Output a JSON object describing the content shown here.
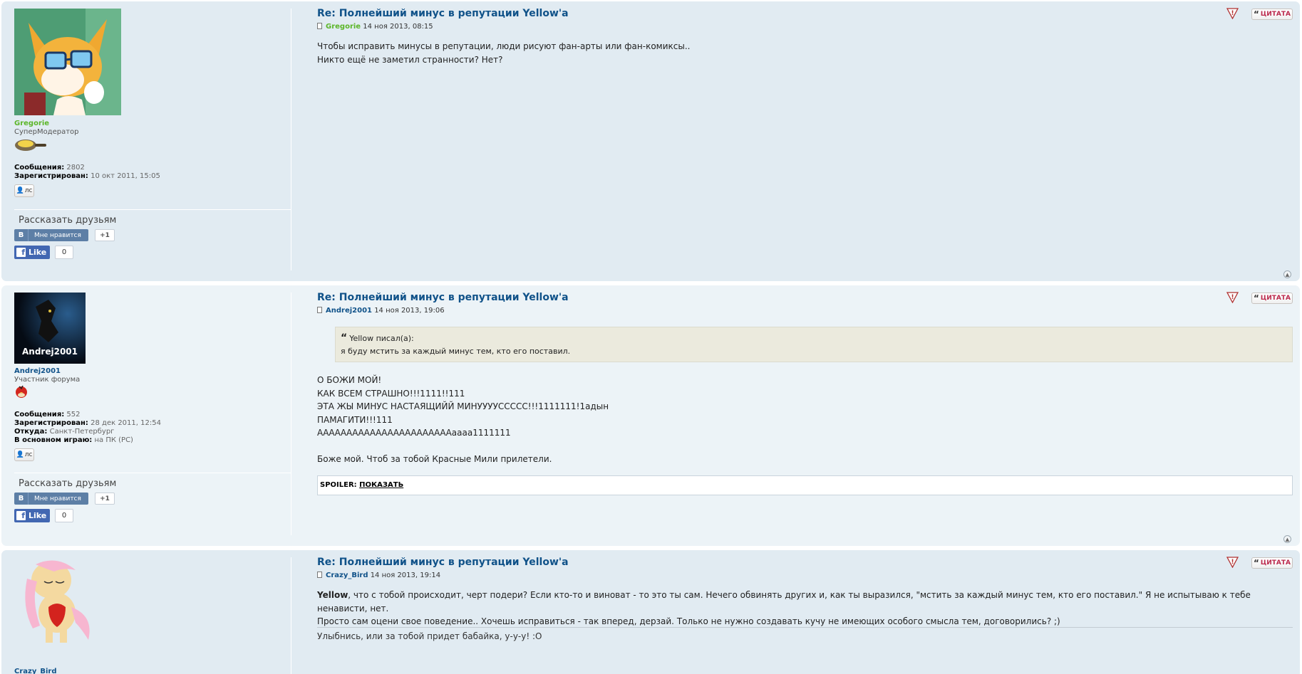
{
  "colors": {
    "post_bg_1": "#e1ebf2",
    "post_bg_2": "#ecf3f7",
    "link": "#105289",
    "moderator": "#5cb629",
    "quote_red": "#bc2a4d"
  },
  "common": {
    "pm_label": "лс",
    "tell_friends": "Рассказать друзьям",
    "vk_letter": "В",
    "vk_like": "Мне нравится",
    "vk_count": "+1",
    "fb_like": "Like",
    "fb_count": "0",
    "quote_label": "ЦИТАТА",
    "report_icon": "warning-icon",
    "top_icon": "arrow-up-icon"
  },
  "posts": [
    {
      "username": "Gregorie",
      "rank": "СуперМодератор",
      "stats": [
        {
          "k": "Сообщения:",
          "v": "2802"
        },
        {
          "k": "Зарегистрирован:",
          "v": "10 окт 2011, 15:05"
        }
      ],
      "title": "Re: Полнейший минус в репутации Yellow'a",
      "author": "Gregorie",
      "date": "14 ноя 2013, 08:15",
      "lines": [
        "Чтобы исправить минусы в репутации, люди рисуют фан-арты или фан-комиксы..",
        "Никто ещё не заметил странности? Нет?"
      ]
    },
    {
      "username": "Andrej2001",
      "avatar_text": "Andrej2001",
      "rank": "Участник форума",
      "stats": [
        {
          "k": "Сообщения:",
          "v": "552"
        },
        {
          "k": "Зарегистрирован:",
          "v": "28 дек 2011, 12:54"
        },
        {
          "k": "Откуда:",
          "v": "Санкт-Петербург"
        },
        {
          "k": "В основном играю:",
          "v": "на ПК (PC)"
        }
      ],
      "title": "Re: Полнейший минус в репутации Yellow'a",
      "author": "Andrej2001",
      "date": "14 ноя 2013, 19:06",
      "quote_author": "Yellow писал(а):",
      "quote_text": "я буду мстить за каждый минус тем, кто его поставил.",
      "lines": [
        "О БОЖИ МОЙ!",
        "КАК ВСЕМ СТРАШНО!!!1111!!111",
        "ЭТА ЖЫ МИНУС НАСТАЯЩИЙЙ МИНУУУУССССС!!!1111111!1адын",
        "ПАМАГИТИ!!!111",
        "АААААААААААААААААААААААаааа1111111",
        "",
        "Боже мой. Чтоб за тобой Красные Мили прилетели."
      ],
      "spoiler_label": "SPOILER:",
      "spoiler_show": "ПОКАЗАТЬ"
    },
    {
      "username": "Crazy_Bird",
      "title": "Re: Полнейший минус в репутации Yellow'a",
      "author": "Crazy_Bird",
      "date": "14 ноя 2013, 19:14",
      "bold_name": "Yellow",
      "line1_rest": ", что с тобой происходит, черт подери? Если кто-то и виноват - то это ты сам. Нечего обвинять других и, как ты выразился, \"мстить за каждый минус тем, кто его поставил.\" Я не испытываю к тебе ненависти, нет.",
      "line2": "Просто сам оцени свое поведение.. Хочешь исправиться - так вперед, дерзай. Только не нужно создавать кучу не имеющих особого смысла тем, договорились? ;)",
      "signature": "Улыбнись, или за тобой придет бабайка, у-у-у! :О"
    }
  ]
}
